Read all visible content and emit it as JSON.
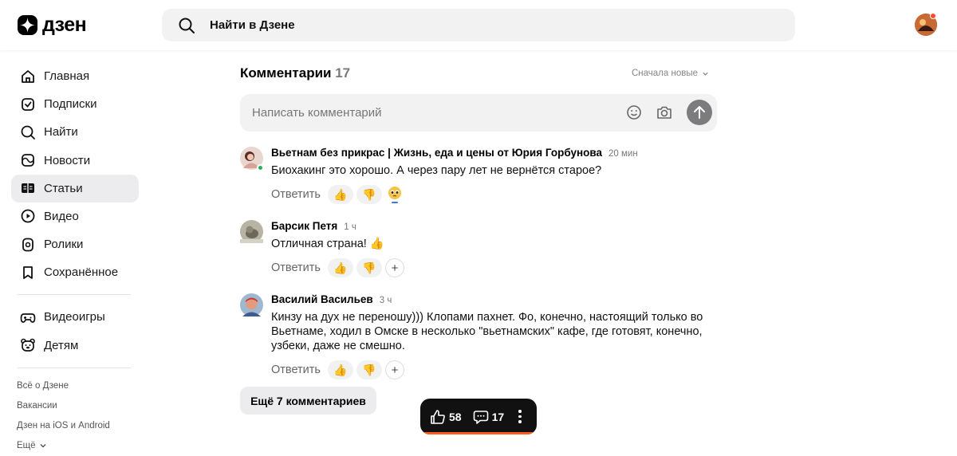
{
  "header": {
    "logo_text": "дзен",
    "search_placeholder": "Найти в Дзене"
  },
  "sidebar": {
    "items": [
      {
        "label": "Главная",
        "icon": "home-icon"
      },
      {
        "label": "Подписки",
        "icon": "subscriptions-icon"
      },
      {
        "label": "Найти",
        "icon": "search-icon"
      },
      {
        "label": "Новости",
        "icon": "news-icon"
      },
      {
        "label": "Статьи",
        "icon": "articles-icon",
        "active": true
      },
      {
        "label": "Видео",
        "icon": "video-icon"
      },
      {
        "label": "Ролики",
        "icon": "shorts-icon"
      },
      {
        "label": "Сохранённое",
        "icon": "bookmark-icon"
      }
    ],
    "items2": [
      {
        "label": "Видеоигры",
        "icon": "gamepad-icon"
      },
      {
        "label": "Детям",
        "icon": "kids-icon"
      }
    ],
    "footer": [
      "Всё о Дзене",
      "Вакансии",
      "Дзен на iOS и Android",
      "Ещё"
    ]
  },
  "comments": {
    "title": "Комментарии",
    "count": "17",
    "sort_label": "Сначала новые",
    "compose_placeholder": "Написать комментарий",
    "reply_label": "Ответить",
    "items": [
      {
        "author": "Вьетнам без прикрас | Жизнь, еда и цены от Юрия Горбунова",
        "time": "20 мин",
        "text": "Биохакинг это хорошо. А через пару лет не вернётся старое?"
      },
      {
        "author": "Барсик Петя",
        "time": "1 ч",
        "text": "Отличная страна! 👍"
      },
      {
        "author": "Василий Васильев",
        "time": "3 ч",
        "text": "Кинзу на дух не переношу))) Клопами пахнет. Фо, конечно, настоящий только во Вьетнаме, ходил в Омске в несколько \"вьетнамских\" кафе, где готовят, конечно, узбеки, даже не смешно."
      }
    ],
    "more_label": "Ещё 7 комментариев"
  },
  "floatbar": {
    "likes": "58",
    "comments": "17",
    "progress": 1.0
  },
  "colors": {
    "accent": "#ff5a1f",
    "active_bg": "#ececee",
    "online": "#24b35a"
  }
}
